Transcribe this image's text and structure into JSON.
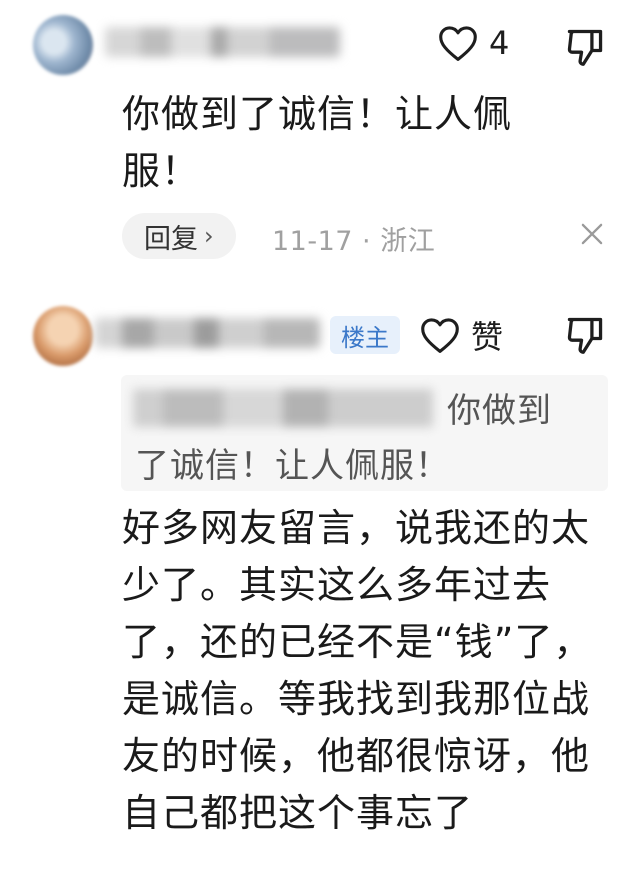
{
  "comments": [
    {
      "likes": "4",
      "text": "你做到了诚信！让人佩服！",
      "reply_label": "回复",
      "reply_chevron": "›",
      "meta": "11-17 · 浙江"
    },
    {
      "badge": "楼主",
      "likes": "赞",
      "quote_text_1": "你做到",
      "quote_text_2": "了诚信！让人佩服！",
      "text": "好多网友留言，说我还的太少了。其实这么多年过去了，还的已经不是“钱”了，是诚信。等我找到我那位战友的时候，他都很惊讶，他自己都把这个事忘了"
    }
  ],
  "icons": {
    "like": "heart-outline-icon",
    "dislike": "thumbs-down-outline-icon",
    "close": "close-icon"
  },
  "colors": {
    "badge_text": "#3b78c9",
    "badge_bg": "#e7f0fb",
    "meta_text": "#a0a0a0"
  }
}
